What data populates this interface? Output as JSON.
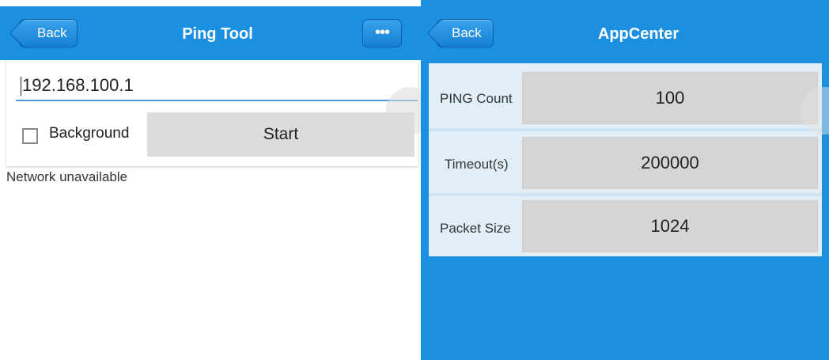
{
  "ping_tool": {
    "back_label": "Back",
    "title": "Ping Tool",
    "more_label": "•••",
    "ip_value": "192.168.100.1",
    "background_label": "Background",
    "start_label": "Start",
    "status_text": "Network unavailable"
  },
  "app_center": {
    "back_label": "Back",
    "title": "AppCenter",
    "rows": [
      {
        "label": "PING Count",
        "value": "100"
      },
      {
        "label": "Timeout(s)",
        "value": "200000"
      },
      {
        "label": "Packet Size",
        "value": "1024"
      }
    ]
  },
  "colors": {
    "header_blue": "#1b8fe0",
    "background_blue": "#1b8fe0"
  }
}
